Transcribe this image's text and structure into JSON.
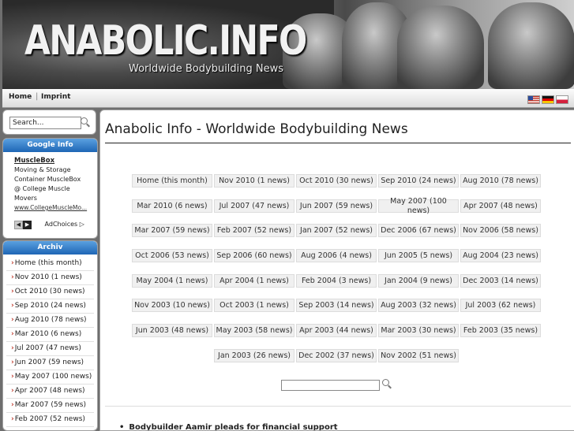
{
  "header": {
    "logo": "ANABOLIC.INFO",
    "tagline": "Worldwide Bodybuilding News"
  },
  "nav": {
    "home": "Home",
    "imprint": "Imprint",
    "flags": [
      "us-flag-icon",
      "de-flag-icon",
      "pl-flag-icon"
    ]
  },
  "sidebar": {
    "search_value": "Search...",
    "google": {
      "heading": "Google Info",
      "ad_title": "MuscleBox",
      "ad_lines": [
        "Moving & Storage",
        "Container MuscleBox",
        "@ College Muscle",
        "Movers"
      ],
      "ad_url": "www.CollegeMuscleMo...",
      "adchoices": "AdChoices"
    },
    "archiv": {
      "heading": "Archiv",
      "items": [
        "Home (this month)",
        "Nov 2010 (1 news)",
        "Oct 2010 (30 news)",
        "Sep 2010 (24 news)",
        "Aug 2010 (78 news)",
        "Mar 2010 (6 news)",
        "Jul 2007 (47 news)",
        "Jun 2007 (59 news)",
        "May 2007 (100 news)",
        "Apr 2007 (48 news)",
        "Mar 2007 (59 news)",
        "Feb 2007 (52 news)"
      ]
    }
  },
  "main": {
    "title": "Anabolic Info - Worldwide Bodybuilding News",
    "archive_grid": [
      [
        "Home (this month)",
        "Nov 2010 (1 news)",
        "Oct 2010 (30 news)",
        "Sep 2010 (24 news)",
        "Aug 2010 (78 news)"
      ],
      [
        "Mar 2010 (6 news)",
        "Jul 2007 (47 news)",
        "Jun 2007 (59 news)",
        "May 2007 (100 news)",
        "Apr 2007 (48 news)"
      ],
      [
        "Mar 2007 (59 news)",
        "Feb 2007 (52 news)",
        "Jan 2007 (52 news)",
        "Dec 2006 (67 news)",
        "Nov 2006 (58 news)"
      ],
      [
        "Oct 2006 (53 news)",
        "Sep 2006 (60 news)",
        "Aug 2006 (4 news)",
        "Jun 2005 (5 news)",
        "Aug 2004 (23 news)"
      ],
      [
        "May 2004 (1 news)",
        "Apr 2004 (1 news)",
        "Feb 2004 (3 news)",
        "Jan 2004 (9 news)",
        "Dec 2003 (14 news)"
      ],
      [
        "Nov 2003 (10 news)",
        "Oct 2003 (1 news)",
        "Sep 2003 (14 news)",
        "Aug 2003 (32 news)",
        "Jul 2003 (62 news)"
      ],
      [
        "Jun 2003 (48 news)",
        "May 2003 (58 news)",
        "Apr 2003 (44 news)",
        "Mar 2003 (30 news)",
        "Feb 2003 (35 news)"
      ],
      [
        "",
        "Jan 2003 (26 news)",
        "Dec 2002 (37 news)",
        "Nov 2002 (51 news)",
        ""
      ]
    ],
    "news_item": "Bodybuilder Aamir pleads for financial support"
  }
}
